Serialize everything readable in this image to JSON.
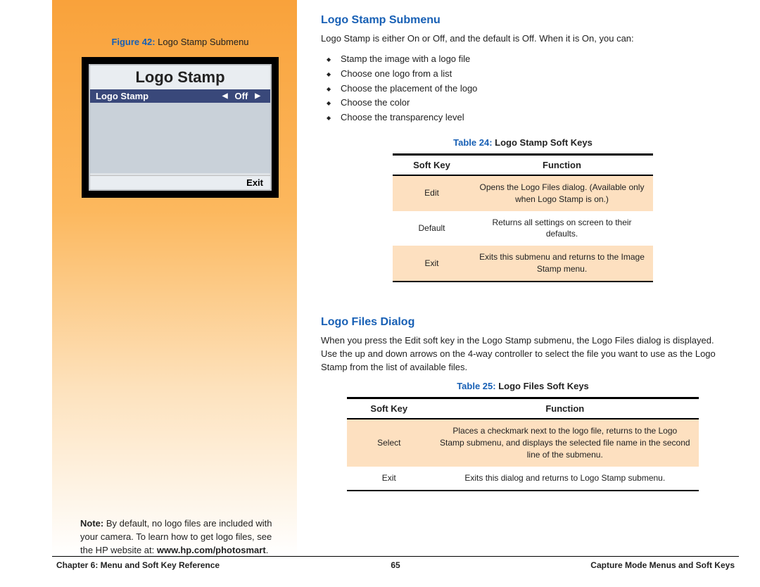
{
  "sidebar": {
    "figure_ref": "Figure 42:",
    "figure_title": " Logo Stamp Submenu",
    "lcd_title": "Logo Stamp",
    "lcd_row_label": "Logo Stamp",
    "lcd_row_value": "Off",
    "lcd_exit": "Exit",
    "note_label": "Note: ",
    "note_body": "By default, no logo files are included with your camera. To learn how to get logo files, see the HP website at: ",
    "note_url": "www.hp.com/photosmart",
    "note_period": "."
  },
  "section1": {
    "heading": "Logo Stamp Submenu",
    "intro": "Logo Stamp is either On or Off, and the default is Off. When it is On, you can:",
    "bullets": [
      "Stamp the image with a logo file",
      "Choose one logo from a list",
      "Choose the placement of the logo",
      "Choose the color",
      "Choose the transparency level"
    ],
    "table_ref": "Table 24:",
    "table_name": " Logo Stamp Soft Keys",
    "headers": {
      "k": "Soft Key",
      "f": "Function"
    },
    "rows": [
      {
        "k": "Edit",
        "f": "Opens the Logo Files dialog. (Available only when Logo Stamp is on.)"
      },
      {
        "k": "Default",
        "f": "Returns all settings on screen to their defaults."
      },
      {
        "k": "Exit",
        "f": "Exits this submenu and returns to the Image Stamp menu."
      }
    ]
  },
  "section2": {
    "heading": "Logo Files Dialog",
    "intro": "When you press the Edit soft key in the Logo Stamp submenu, the Logo Files dialog is displayed. Use the up and down arrows on the 4-way controller to select the file you want to use as the Logo Stamp from the list of available files.",
    "table_ref": "Table 25:",
    "table_name": " Logo Files Soft Keys",
    "headers": {
      "k": "Soft Key",
      "f": "Function"
    },
    "rows": [
      {
        "k": "Select",
        "f": "Places a checkmark next to the logo file, returns to the Logo Stamp submenu, and displays the selected file name in the second line of the submenu."
      },
      {
        "k": "Exit",
        "f": "Exits this dialog and returns to Logo Stamp submenu."
      }
    ]
  },
  "footer": {
    "left": "Chapter 6: Menu and Soft Key Reference",
    "center": "65",
    "right": "Capture Mode Menus and Soft Keys"
  }
}
